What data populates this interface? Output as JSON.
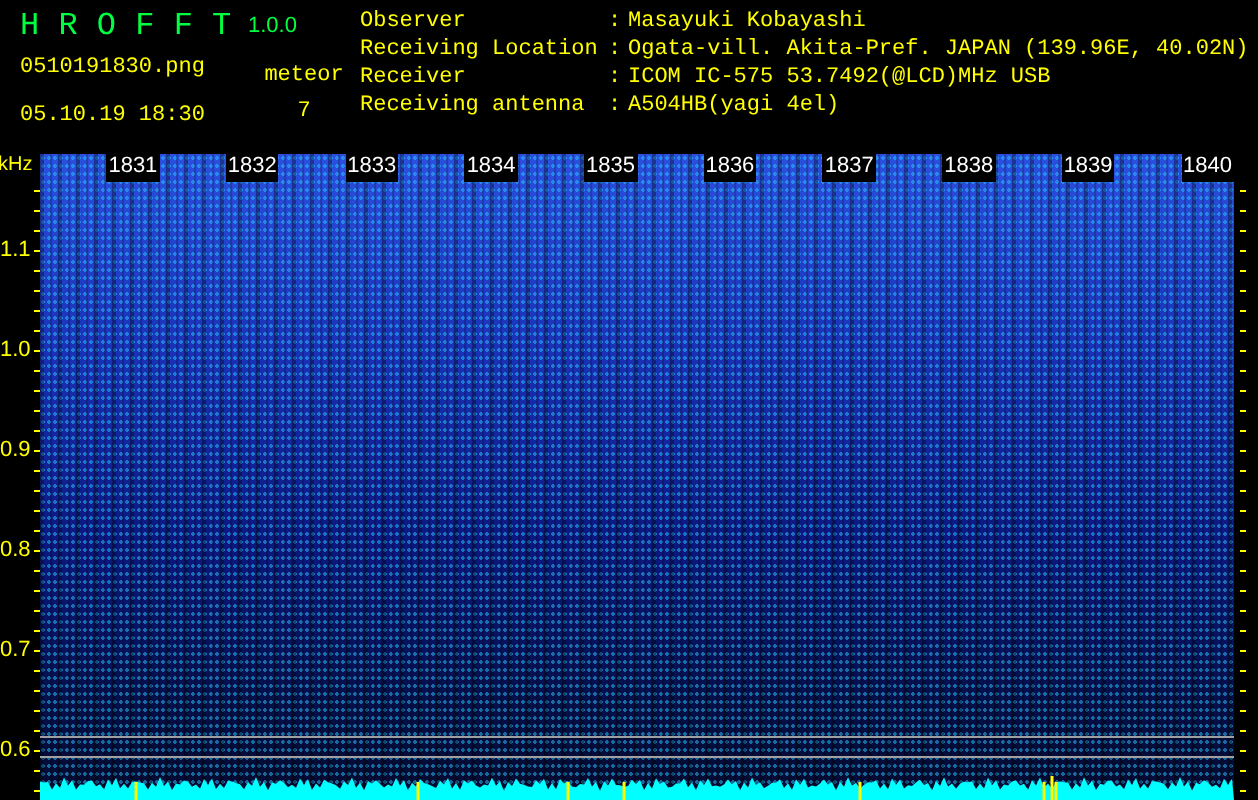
{
  "app": {
    "name": "H R O F F T",
    "version": "1.0.0"
  },
  "file": "0510191830.png",
  "datetime": "05.10.19 18:30",
  "meteor": {
    "label": "meteor",
    "count": "7"
  },
  "station": [
    {
      "label": "Observer",
      "separator": ":",
      "value": "Masayuki Kobayashi"
    },
    {
      "label": "Receiving Location",
      "separator": ":",
      "value": "Ogata-vill. Akita-Pref. JAPAN (139.96E, 40.02N)"
    },
    {
      "label": "Receiver",
      "separator": ":",
      "value": "ICOM IC-575 53.7492(@LCD)MHz USB"
    },
    {
      "label": "Receiving antenna",
      "separator": ":",
      "value": "A504HB(yagi 4el)"
    }
  ],
  "spectrogram": {
    "unit": "kHz",
    "time_labels": [
      "1831",
      "1832",
      "1833",
      "1834",
      "1835",
      "1836",
      "1837",
      "1838",
      "1839",
      "1840"
    ],
    "frequency_labels": [
      "1.1",
      "1.0",
      "0.9",
      "0.8",
      "0.7",
      "0.6"
    ]
  }
}
